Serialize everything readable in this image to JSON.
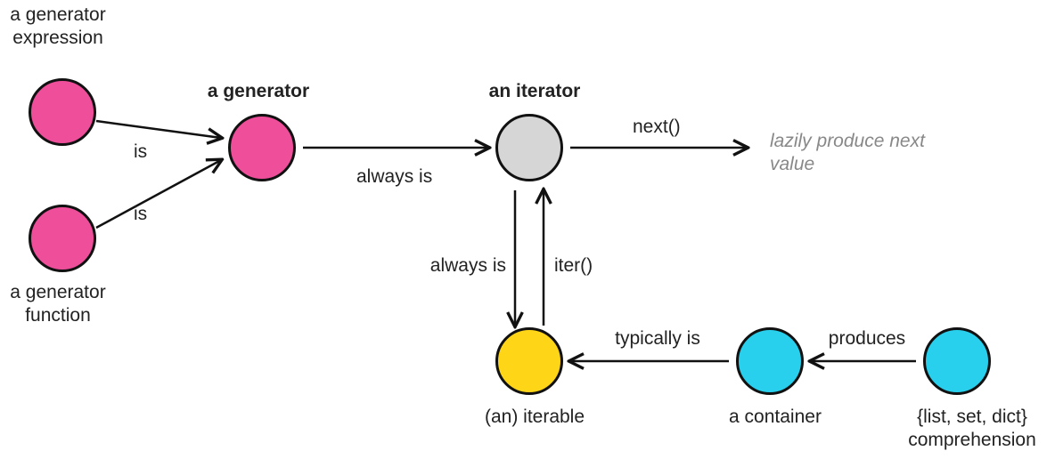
{
  "nodes": {
    "gen_expr": {
      "label": "a generator\nexpression",
      "color": "pink"
    },
    "gen_func": {
      "label": "a generator\nfunction",
      "color": "pink"
    },
    "generator": {
      "label": "a generator",
      "color": "pink"
    },
    "iterator": {
      "label": "an iterator",
      "color": "grey"
    },
    "iterable": {
      "label": "(an) iterable",
      "color": "yellow"
    },
    "container": {
      "label": "a container",
      "color": "cyan"
    },
    "comprehension": {
      "label": "{list, set, dict}\ncomprehension",
      "color": "cyan"
    }
  },
  "edges": {
    "expr_to_gen": {
      "label": "is"
    },
    "func_to_gen": {
      "label": "is"
    },
    "gen_to_iter": {
      "label": "always is"
    },
    "iter_to_next": {
      "label": "next()"
    },
    "iter_to_iterable_down": {
      "label": "always is"
    },
    "iterable_to_iter_up": {
      "label": "iter()"
    },
    "container_to_iterable": {
      "label": "typically is"
    },
    "comp_to_container": {
      "label": "produces"
    }
  },
  "annotations": {
    "lazy": "lazily produce\nnext value"
  },
  "colors": {
    "pink": "#ef4e9b",
    "grey": "#d6d6d6",
    "yellow": "#ffd518",
    "cyan": "#28d0ed",
    "stroke": "#111111",
    "muted": "#888888"
  }
}
